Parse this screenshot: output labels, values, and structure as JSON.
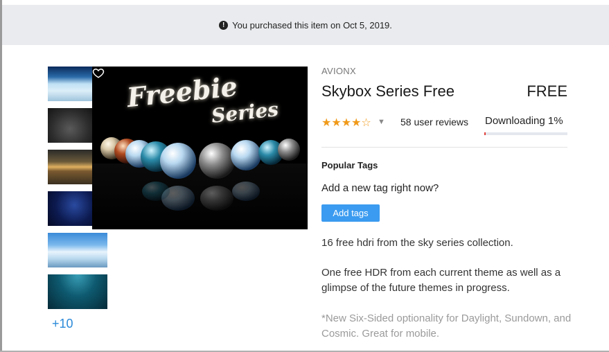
{
  "notice": {
    "icon": "info-icon",
    "text": "You purchased this item on Oct 5, 2019."
  },
  "gallery": {
    "thumbnails": [
      {
        "icon": "sky-clouds-thumbnail"
      },
      {
        "icon": "dark-clouds-thumbnail"
      },
      {
        "icon": "sunset-thumbnail"
      },
      {
        "icon": "cosmic-thumbnail"
      },
      {
        "icon": "daylight-thumbnail"
      },
      {
        "icon": "underwater-thumbnail"
      }
    ],
    "more_label": "+10",
    "hero_lines": [
      "Freebie",
      "Series"
    ]
  },
  "product": {
    "publisher": "AVIONX",
    "title": "Skybox Series Free",
    "price": "FREE",
    "rating": 4,
    "rating_max": 5,
    "reviews_label": "58 user reviews",
    "download_label": "Downloading 1%",
    "download_progress": 0.01
  },
  "tags": {
    "heading": "Popular Tags",
    "prompt": "Add a new tag right now?",
    "button_label": "Add tags"
  },
  "description": {
    "line1": "16 free hdri from the sky series collection.",
    "line2": "One free HDR from each current theme as well as a glimpse of the future themes in progress.",
    "line3": "*New Six-Sided optionality for Daylight, Sundown, and Cosmic. Great for mobile."
  },
  "colors": {
    "accent": "#3b9bf0",
    "star": "#f09a1a",
    "progress": "#e0403a",
    "link": "#2b8ad9"
  }
}
